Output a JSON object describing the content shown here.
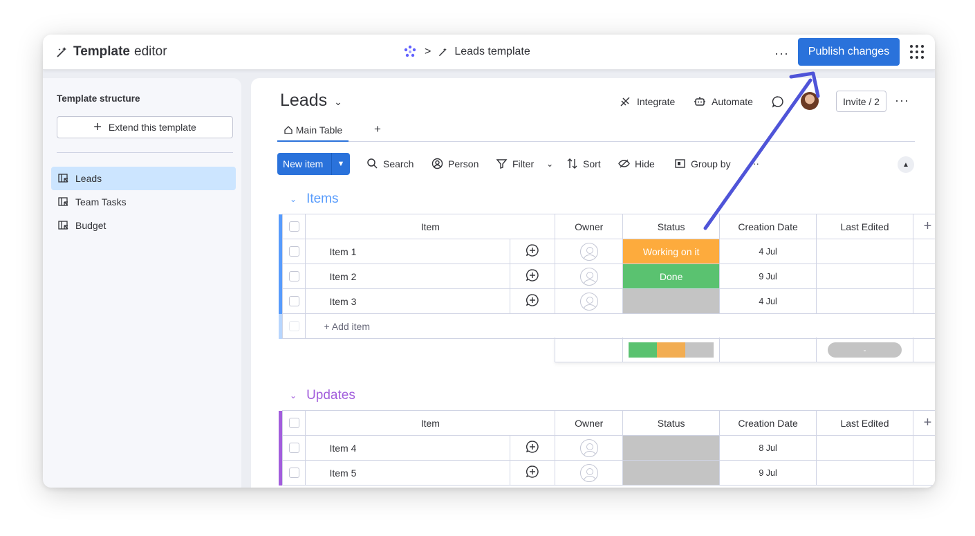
{
  "topbar": {
    "title_bold": "Template",
    "title_rest": "editor",
    "breadcrumb_sep": ">",
    "breadcrumb_template": "Leads template",
    "more_label": "···",
    "publish_label": "Publish changes"
  },
  "sidebar": {
    "title": "Template structure",
    "extend_label": "Extend this template",
    "items": [
      {
        "label": "Leads",
        "active": true
      },
      {
        "label": "Team Tasks",
        "active": false
      },
      {
        "label": "Budget",
        "active": false
      }
    ]
  },
  "board": {
    "title": "Leads",
    "integrate_label": "Integrate",
    "automate_label": "Automate",
    "invite_label": "Invite / 2",
    "tab_main": "Main Table",
    "tab_add": "+"
  },
  "toolbar": {
    "new_item": "New item",
    "search": "Search",
    "person": "Person",
    "filter": "Filter",
    "sort": "Sort",
    "hide": "Hide",
    "group_by": "Group by",
    "more": "···"
  },
  "columns": [
    "Item",
    "Owner",
    "Status",
    "Creation Date",
    "Last Edited"
  ],
  "groups": [
    {
      "name": "Items",
      "color": "#579bfc",
      "rows": [
        {
          "item": "Item 1",
          "status": "Working on it",
          "status_color": "#fdab3d",
          "date": "4 Jul"
        },
        {
          "item": "Item 2",
          "status": "Done",
          "status_color": "#00c875",
          "date": "9 Jul"
        },
        {
          "item": "Item 3",
          "status": "",
          "status_color": "#c4c4c4",
          "date": "4 Jul"
        }
      ],
      "add_item_label": "+ Add item",
      "summary_pill": "-"
    },
    {
      "name": "Updates",
      "color": "#a25ddc",
      "rows": [
        {
          "item": "Item 4",
          "status": "",
          "status_color": "#c4c4c4",
          "date": "8 Jul"
        },
        {
          "item": "Item 5",
          "status": "",
          "status_color": "#c4c4c4",
          "date": "9 Jul"
        }
      ]
    }
  ],
  "colors": {
    "accent": "#2a72db",
    "annotation_arrow": "#4f54d8"
  }
}
